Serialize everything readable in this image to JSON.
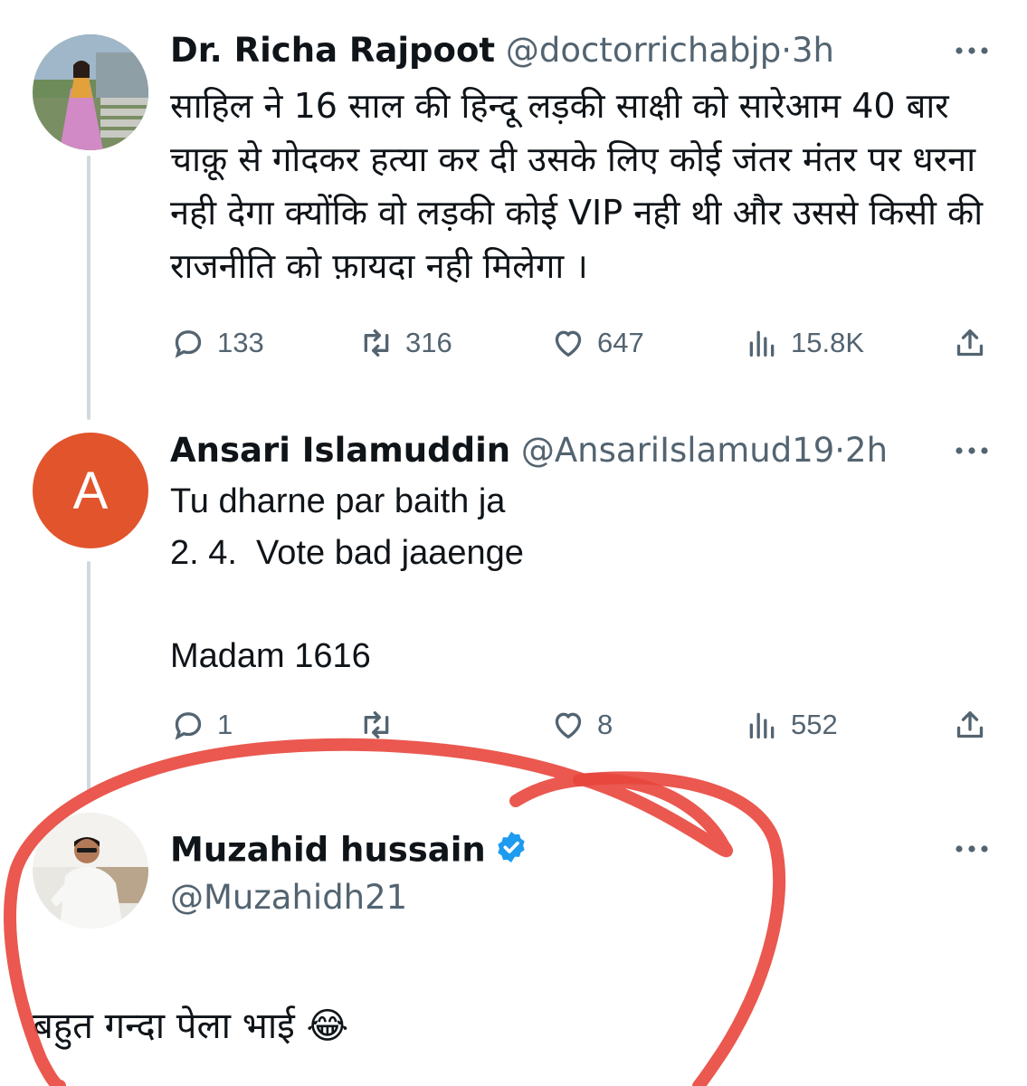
{
  "tweets": [
    {
      "name": "Dr. Richa Rajpoot",
      "handle": "@doctorrichabjp",
      "time": "3h",
      "text": "साहिल ने 16 साल की हिन्दू लड़की साक्षी को सारेआम 40 बार चाक़ू से गोदकर हत्या कर दी उसके लिए कोई जंतर मंतर पर धरना नही देगा क्योंकि वो लड़की कोई VIP नही थी और उससे किसी की राजनीति को फ़ायदा नही मिलेगा ।",
      "replies": "133",
      "retweets": "316",
      "likes": "647",
      "views": "15.8K"
    },
    {
      "name": "Ansari Islamuddin",
      "handle": "@AnsariIslamud19",
      "time": "2h",
      "avatar_letter": "A",
      "text": "Tu dharne par baith ja\n2. 4.  Vote bad jaaenge\n\nMadam 1616",
      "replies": "1",
      "retweets": "",
      "likes": "8",
      "views": "552"
    },
    {
      "name": "Muzahid hussain",
      "handle": "@Muzahidh21",
      "verified": true,
      "text": "बहुत गन्दा पेला भाई 😂"
    }
  ],
  "colors": {
    "text": "#0f1419",
    "secondary": "#536471",
    "thread_line": "#cfd9de",
    "avatar_a": "#e1542c",
    "verified": "#1d9bf0",
    "annotation": "#e8463c"
  },
  "icons": [
    "reply-icon",
    "retweet-icon",
    "like-icon",
    "views-icon",
    "share-icon",
    "more-icon",
    "verified-badge-icon",
    "tears-of-joy-emoji"
  ]
}
